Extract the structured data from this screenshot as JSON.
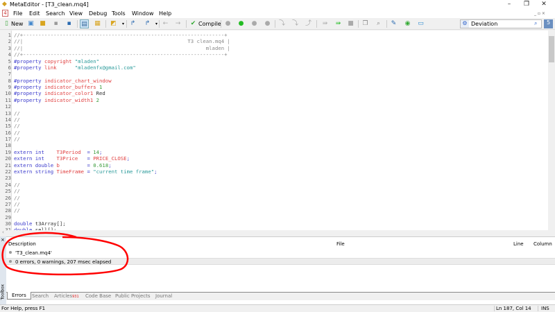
{
  "window": {
    "title": "MetaEditor - [T3_clean.mq4]",
    "minimize": "–",
    "restore": "❐",
    "close": "✕"
  },
  "menu": [
    "File",
    "Edit",
    "Search",
    "View",
    "Debug",
    "Tools",
    "Window",
    "Help"
  ],
  "toolbar": {
    "new_label": "New",
    "compile_label": "Compile",
    "search_value": "Deviation"
  },
  "code": [
    [
      [
        "//+------------------------------------------------------------------+",
        "cm"
      ]
    ],
    [
      [
        "//|                                                      T3 clean.mq4 |",
        "cm"
      ]
    ],
    [
      [
        "//|                                                            mladen |",
        "cm"
      ]
    ],
    [
      [
        "//+------------------------------------------------------------------+",
        "cm"
      ]
    ],
    [
      [
        "#property ",
        "kw"
      ],
      [
        "copyright ",
        "pr"
      ],
      [
        "\"mladen\"",
        "st"
      ]
    ],
    [
      [
        "#property ",
        "kw"
      ],
      [
        "link      ",
        "pr"
      ],
      [
        "\"mladenfx@gmail.com\"",
        "st"
      ]
    ],
    [],
    [
      [
        "#property ",
        "kw"
      ],
      [
        "indicator_chart_window",
        "pr"
      ]
    ],
    [
      [
        "#property ",
        "kw"
      ],
      [
        "indicator_buffers ",
        "pr"
      ],
      [
        "1",
        "nm"
      ]
    ],
    [
      [
        "#property ",
        "kw"
      ],
      [
        "indicator_color1 ",
        "pr"
      ],
      [
        "Red",
        "tx"
      ]
    ],
    [
      [
        "#property ",
        "kw"
      ],
      [
        "indicator_width1 ",
        "pr"
      ],
      [
        "2",
        "nm"
      ]
    ],
    [],
    [
      [
        "//",
        "cm"
      ]
    ],
    [
      [
        "//",
        "cm"
      ]
    ],
    [
      [
        "//",
        "cm"
      ]
    ],
    [
      [
        "//",
        "cm"
      ]
    ],
    [
      [
        "//",
        "cm"
      ]
    ],
    [],
    [
      [
        "extern int    ",
        "kw"
      ],
      [
        "T3Period  ",
        "pr"
      ],
      [
        "= ",
        "kw"
      ],
      [
        "14",
        "nm"
      ],
      [
        ";",
        "kw"
      ]
    ],
    [
      [
        "extern int    ",
        "kw"
      ],
      [
        "T3Price   ",
        "pr"
      ],
      [
        "= ",
        "kw"
      ],
      [
        "PRICE_CLOSE",
        "pr"
      ],
      [
        ";",
        "kw"
      ]
    ],
    [
      [
        "extern double ",
        "kw"
      ],
      [
        "b         ",
        "pr"
      ],
      [
        "= ",
        "kw"
      ],
      [
        "0.618",
        "nm"
      ],
      [
        ";",
        "kw"
      ]
    ],
    [
      [
        "extern string ",
        "kw"
      ],
      [
        "TimeFrame ",
        "pr"
      ],
      [
        "= ",
        "kw"
      ],
      [
        "\"current time frame\"",
        "st"
      ],
      [
        ";",
        "kw"
      ]
    ],
    [],
    [
      [
        "//",
        "cm"
      ]
    ],
    [
      [
        "//",
        "cm"
      ]
    ],
    [
      [
        "//",
        "cm"
      ]
    ],
    [
      [
        "//",
        "cm"
      ]
    ],
    [
      [
        "//",
        "cm"
      ]
    ],
    [],
    [
      [
        "double ",
        "kw"
      ],
      [
        "t3Array[];",
        "tx"
      ]
    ],
    [
      [
        "double ",
        "kw"
      ],
      [
        "sell[];",
        "tx"
      ]
    ]
  ],
  "toolbox": {
    "side_label": "Toolbox",
    "columns": [
      "Description",
      "File",
      "Line",
      "Column"
    ],
    "rows": [
      "'T3_clean.mq4'",
      "0 errors, 0 warnings, 207 msec elapsed"
    ],
    "tabs": [
      "Errors",
      "Search",
      "Articles",
      "Code Base",
      "Public Projects",
      "Journal"
    ],
    "articles_badge": "931"
  },
  "status": {
    "help": "For Help, press F1",
    "position": "Ln 187, Col 14",
    "mode": "INS"
  },
  "colors": {
    "annotation": "#ff0000",
    "keyword": "#3a3acc",
    "property": "#e04040",
    "string": "#2a9a9a"
  }
}
